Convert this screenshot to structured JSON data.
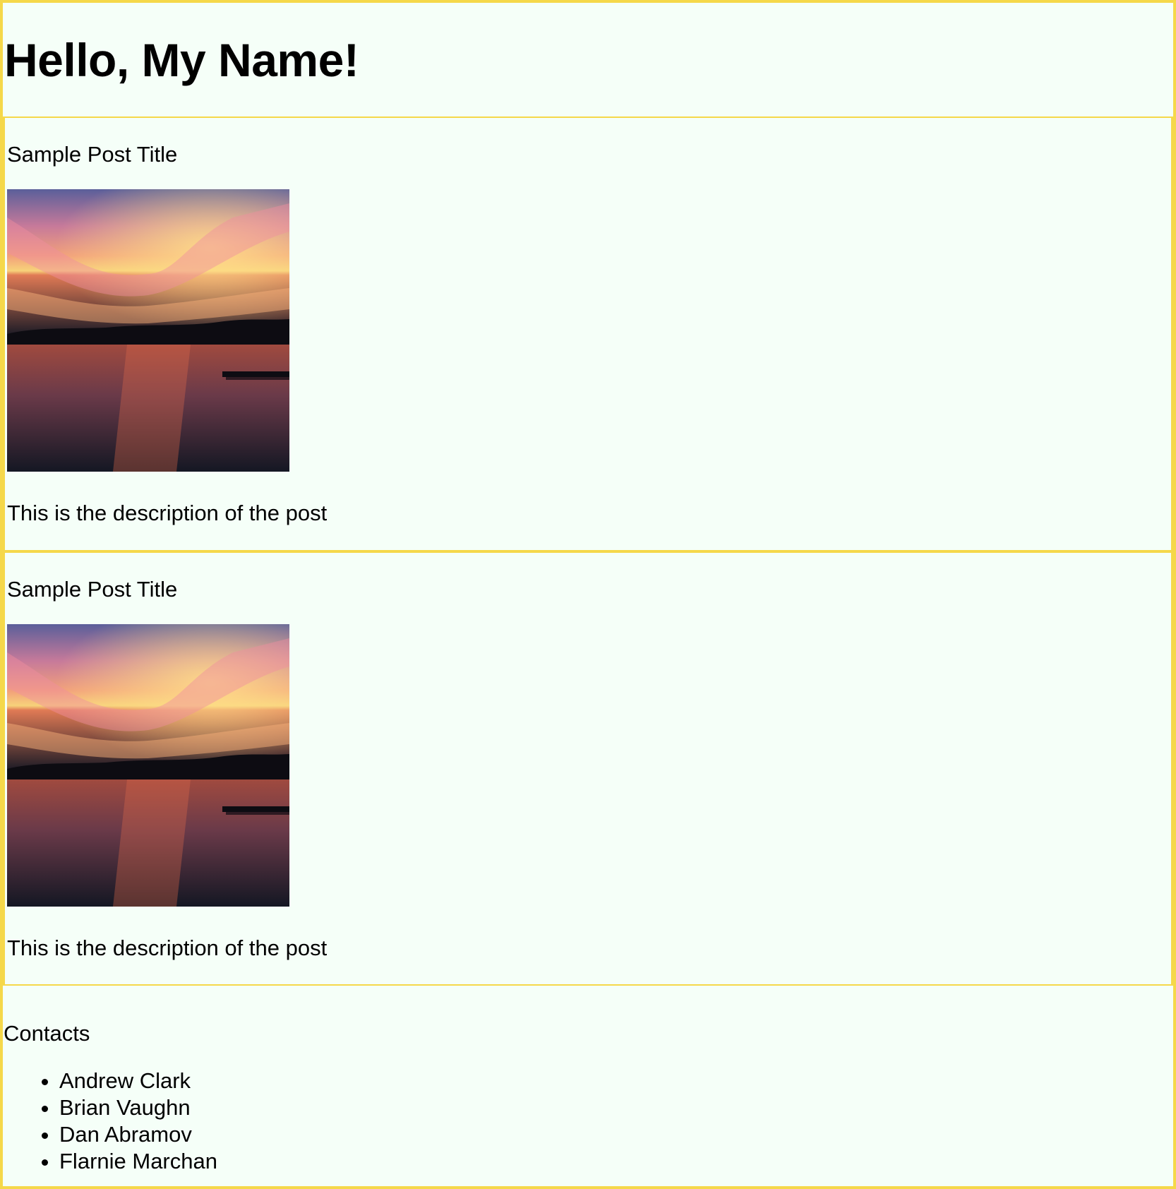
{
  "header": {
    "title": "Hello, My Name!"
  },
  "posts": [
    {
      "title": "Sample Post Title",
      "image_alt": "sunset-over-lake",
      "description": "This is the description of the post"
    },
    {
      "title": "Sample Post Title",
      "image_alt": "sunset-over-lake",
      "description": "This is the description of the post"
    }
  ],
  "contacts": {
    "title": "Contacts",
    "items": [
      "Andrew Clark",
      "Brian Vaughn",
      "Dan Abramov",
      "Flarnie Marchan"
    ]
  },
  "colors": {
    "border": "#f5d84a",
    "background": "#f5fff8"
  }
}
